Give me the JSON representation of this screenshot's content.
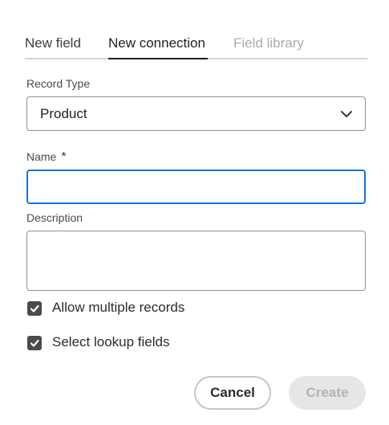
{
  "tabs": {
    "items": [
      {
        "label": "New field",
        "state": "default"
      },
      {
        "label": "New connection",
        "state": "selected"
      },
      {
        "label": "Field library",
        "state": "disabled"
      }
    ]
  },
  "form": {
    "record_type": {
      "label": "Record Type",
      "value": "Product",
      "icon": "chevron-down-icon"
    },
    "name": {
      "label": "Name",
      "required_mark": "*",
      "value": "",
      "focused": true
    },
    "description": {
      "label": "Description",
      "value": ""
    },
    "options": [
      {
        "label": "Allow multiple records",
        "checked": true
      },
      {
        "label": "Select lookup fields",
        "checked": true
      }
    ]
  },
  "footer": {
    "cancel_label": "Cancel",
    "create_label": "Create",
    "create_enabled": false
  },
  "colors": {
    "focus_border": "#1473e6",
    "checkbox_fill": "#4b4b4b",
    "tab_selected": "#1f1f1f",
    "tab_disabled": "#acacac"
  }
}
